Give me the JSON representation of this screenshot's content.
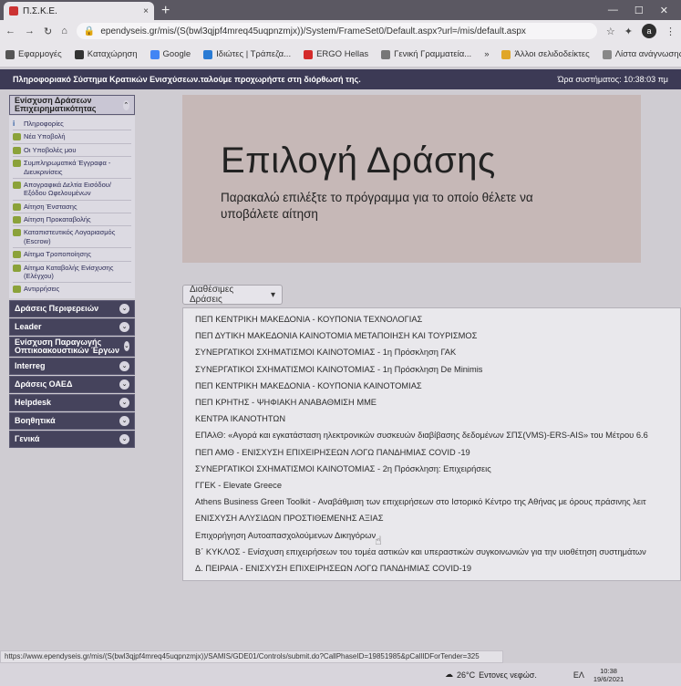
{
  "browser": {
    "tab_title": "Π.Σ.Κ.Ε.",
    "tab_close": "×",
    "new_tab": "+",
    "url": "ependyseis.gr/mis/(S(bwl3qjpf4mreq45uqpnzmjx))/System/FrameSet0/Default.aspx?url=/mis/default.aspx",
    "avatar_letter": "a",
    "bookmarks": [
      {
        "label": "Εφαρμογές",
        "color": "#555555"
      },
      {
        "label": "Καταχώρηση",
        "color": "#333333"
      },
      {
        "label": "Google",
        "color": "#4285f4"
      },
      {
        "label": "Ιδιώτες | Τράπεζα...",
        "color": "#2a7bd4"
      },
      {
        "label": "ERGO Hellas",
        "color": "#d42a2a"
      },
      {
        "label": "Γενική Γραμματεία...",
        "color": "#777777"
      }
    ],
    "bookmarks_overflow": "»",
    "other_bookmarks": "Άλλοι σελιδοδείκτες",
    "reading_list": "Λίστα ανάγνωσης",
    "status_url": "https://www.ependyseis.gr/mis/(S(bwl3qjpf4mreq45uqpnzmjx))/SAMIS/GDE01/Controls/submit.do?CallPhaseID=19851985&pCallIDForTender=325"
  },
  "header": {
    "system_title": "Πληροφοριακό Σύστημα Κρατικών Ενισχύσεων. ",
    "system_subtitle": "ταλούμε προχωρήστε στη διόρθωσή της.",
    "clock": "Ώρα συστήματος: 10:38:03 πμ"
  },
  "sidebar": {
    "open_section": "Ενίσχυση Δράσεων Επιχειρηματικότητας",
    "items": [
      "Πληροφορίες",
      "Νέα Υποβολή",
      "Οι Υποβολές μου",
      "Συμπληρωματικά Έγγραφα - Διευκρινίσεις",
      "Απογραφικά Δελτία Εισόδου/ Εξόδου Ωφελουμένων",
      "Αίτηση Ένστασης",
      "Αίτηση Προκαταβολής",
      "Καταπιστευτικός Λογαριασμός (Escrow)",
      "Αίτημα Τροποποίησης",
      "Αίτημα Καταβολής Ενίσχυσης (Ελέγχου)",
      "Αντιρρήσεις"
    ],
    "sections": [
      "Δράσεις Περιφερειών",
      "Leader",
      "Ενίσχυση Παραγωγής Οπτικοακουστικών Έργων",
      "Interreg",
      "Δράσεις ΟΑΕΔ",
      "Helpdesk",
      "Βοηθητικά",
      "Γενικά"
    ]
  },
  "main": {
    "title": "Επιλογή Δράσης",
    "subtitle": "Παρακαλώ επιλέξτε το πρόγραμμα για το οποίο θέλετε να υποβάλετε αίτηση",
    "dropdown_label": "Διαθέσιμες Δράσεις",
    "actions": [
      "ΠΕΠ ΚΕΝΤΡΙΚΗ ΜΑΚΕΔΟΝΙΑ - ΚΟΥΠΟΝΙΑ ΤΕΧΝΟΛΟΓΙΑΣ",
      "ΠΕΠ ΔΥΤΙΚΗ ΜΑΚΕΔΟΝΙΑ ΚΑΙΝΟΤΟΜΙΑ ΜΕΤΑΠΟΙΗΣΗ ΚΑΙ ΤΟΥΡΙΣΜΟΣ",
      "ΣΥΝΕΡΓΑΤΙΚΟΙ ΣΧΗΜΑΤΙΣΜΟΙ ΚΑΙΝΟΤΟΜΙΑΣ - 1η Πρόσκληση ΓΑΚ",
      "ΣΥΝΕΡΓΑΤΙΚΟΙ ΣΧΗΜΑΤΙΣΜΟΙ ΚΑΙΝΟΤΟΜΙΑΣ - 1η Πρόσκληση De Minimis",
      "ΠΕΠ ΚΕΝΤΡΙΚΗ ΜΑΚΕΔΟΝΙΑ - ΚΟΥΠΟΝΙΑ ΚΑΙΝΟΤΟΜΙΑΣ",
      "ΠΕΠ ΚΡΗΤΗΣ - ΨΗΦΙΑΚΗ ΑΝΑΒΑΘΜΙΣΗ ΜΜΕ",
      "ΚΕΝΤΡΑ ΙΚΑΝΟΤΗΤΩΝ",
      "ΕΠΑλΘ: «Αγορά και εγκατάσταση ηλεκτρονικών συσκευών διαβίβασης δεδομένων ΣΠΣ(VMS)-ERS-AIS» του Μέτρου 6.6",
      "ΠΕΠ ΑΜΘ - ΕΝΙΣΧΥΣΗ ΕΠΙΧΕΙΡΗΣΕΩΝ ΛΟΓΩ ΠΑΝΔΗΜΙΑΣ COVID -19",
      "ΣΥΝΕΡΓΑΤΙΚΟΙ ΣΧΗΜΑΤΙΣΜΟΙ ΚΑΙΝΟΤΟΜΙΑΣ - 2η Πρόσκληση: Επιχειρήσεις",
      "ΓΓΕΚ - Elevate Greece",
      "Athens Business Green Toolkit - Αναβάθμιση των επιχειρήσεων στο Ιστορικό Κέντρο της Αθήνας με όρους πράσινης λειτ",
      "ΕΝΙΣΧΥΣΗ ΑΛΥΣΙΔΩΝ ΠΡΟΣΤΙΘΕΜΕΝΗΣ ΑΞΙΑΣ",
      "Επιχορήγηση Αυτοαπασχολούμενων Δικηγόρων",
      "Β΄ ΚΥΚΛΟΣ - Ενίσχυση επιχειρήσεων του τομέα αστικών και υπεραστικών συγκοινωνιών για την υιοθέτηση συστημάτων",
      "Δ. ΠΕΙΡΑΙΑ - ΕΝΙΣΧΥΣΗ ΕΠΙΧΕΙΡΗΣΕΩΝ ΛΟΓΩ ΠΑΝΔΗΜΙΑΣ COVID-19"
    ]
  },
  "taskbar": {
    "temperature": "26°C",
    "weather": "Εντονες νεφώσ.",
    "lang": "ΕΛ",
    "time": "10:38",
    "date": "19/6/2021"
  },
  "colors": {
    "appbar": "#3c3a55",
    "sidebar_header": "#45435c",
    "hero": "#c6b8b7"
  }
}
